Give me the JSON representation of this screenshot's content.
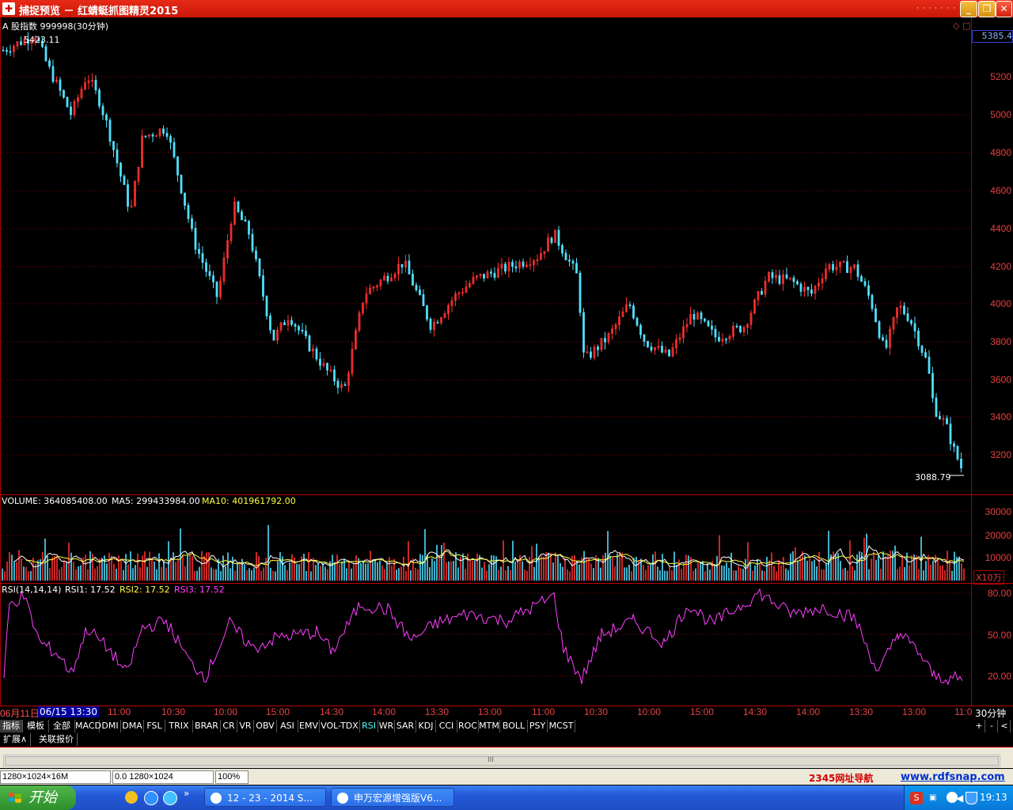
{
  "window": {
    "title": "捕捉预览 － 红蜻蜓抓图精灵2015",
    "app_icon": "capture-app-icon",
    "minimize_label": "_",
    "restore_label": "❐",
    "close_label": "✕"
  },
  "chart": {
    "header": "A 股指数 999998(30分钟)",
    "high_label": "5423.11",
    "low_label": "3088.79",
    "current_price": "5385.4",
    "price_ticks": [
      "5200",
      "5000",
      "4800",
      "4600",
      "4400",
      "4200",
      "4000",
      "3800",
      "3600",
      "3400",
      "3200"
    ],
    "corner_icons": [
      "◇",
      "□"
    ]
  },
  "volume": {
    "label": "VOLUME: 364085408.00",
    "ma5": "MA5: 299433984.00",
    "ma10": "MA10: 401961792.00",
    "ticks": [
      "30000",
      "20000",
      "10000"
    ],
    "unit": "X10万"
  },
  "rsi": {
    "label": "RSI(14,14,14)",
    "rsi1": "RSI1: 17.52",
    "rsi2": "RSI2: 17.52",
    "rsi3": "RSI3: 17.52",
    "ticks": [
      "80.00",
      "50.00",
      "20.00"
    ]
  },
  "time_axis": {
    "start_date": "06月11日",
    "cursor_date": "06/15 13:30",
    "labels": [
      "11:00",
      "10:30",
      "10:00",
      "15:00",
      "14:30",
      "14:00",
      "13:30",
      "13:00",
      "11:00",
      "10:30",
      "10:00",
      "15:00",
      "14:30",
      "14:00",
      "13:30",
      "13:00",
      "11:0"
    ],
    "period": "30分钟"
  },
  "indicator_tabs": [
    "指标",
    "模板",
    "全部",
    "MACD",
    "DMI",
    "DMA",
    "FSL",
    "TRIX",
    "BRAR",
    "CR",
    "VR",
    "OBV",
    "ASI",
    "EMV",
    "VOL-TDX",
    "RSI",
    "WR",
    "SAR",
    "KDJ",
    "CCI",
    "ROC",
    "MTM",
    "BOLL",
    "PSY",
    "MCST"
  ],
  "active_tab": "RSI",
  "tab_controls": [
    "+",
    "-",
    "<"
  ],
  "extension_tabs": [
    "扩展∧",
    "关联报价"
  ],
  "scrollbar": {
    "grip": "III"
  },
  "statusbar": {
    "size": "1280×1024×16M",
    "coords": "0.0 1280×1024",
    "zoom": "100%",
    "ad_text": "2345网址导航",
    "ad_link": "www.rdfsnap.com"
  },
  "taskbar": {
    "start_label": "开始",
    "quick_launch": [
      "show-desktop-icon",
      "ie-icon",
      "media-icon"
    ],
    "more": "»",
    "tasks": [
      "12 - 23 - 2014 S...",
      "申万宏源增强版V6..."
    ],
    "clock": "19:13",
    "tray_icons": [
      "sogou-icon",
      "bluetooth-icon",
      "network-icon",
      "volume-icon",
      "shield-icon"
    ]
  },
  "colors": {
    "up": "#ff3030",
    "down": "#50e0ff",
    "grid": "#a00000",
    "ma5": "#ffffff",
    "ma10": "#ffff40",
    "rsi": "#ff40ff"
  }
}
